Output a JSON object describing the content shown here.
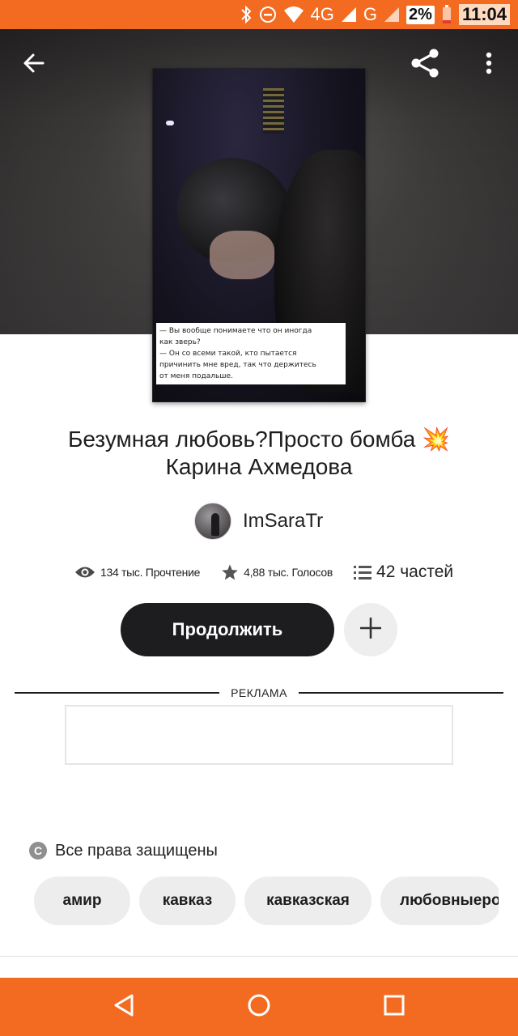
{
  "status_bar": {
    "network_4g": "4G",
    "network_g": "G",
    "battery": "2%",
    "time": "11:04",
    "bar_color": "#f26b21"
  },
  "header": {
    "back_icon": "arrow-left-icon",
    "share_icon": "share-icon",
    "menu_icon": "more-vertical-icon"
  },
  "cover": {
    "caption_lines": [
      "— Вы вообще понимаете что он иногда",
      "как зверь?",
      "— Он со всеми такой, кто пытается",
      "причинить мне вред, так что держитесь",
      "от меня подальше."
    ]
  },
  "story": {
    "title_line1": "Безумная любовь?Просто бомба 💥",
    "title_line2": "Карина Ахмедова",
    "author": "ImSaraTr"
  },
  "stats": {
    "reads": "134 тыс. Прочтение",
    "votes": "4,88 тыс. Голосов",
    "parts": "42 частей"
  },
  "actions": {
    "continue_label": "Продолжить",
    "add_icon": "plus-icon"
  },
  "ad": {
    "label": "РЕКЛАМА"
  },
  "copyright": {
    "text": "Все права защищены"
  },
  "tags": [
    "амир",
    "кавказ",
    "кавказская",
    "любовныеро"
  ],
  "nav": {
    "back_icon": "triangle-back-icon",
    "home_icon": "circle-home-icon",
    "recents_icon": "square-recents-icon"
  }
}
